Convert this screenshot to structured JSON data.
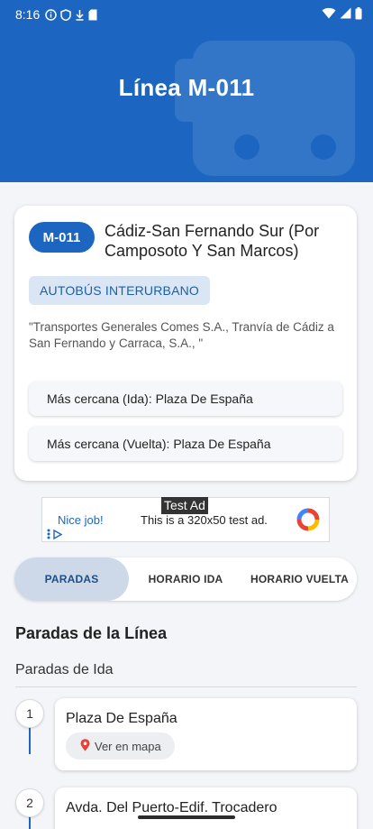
{
  "status_bar": {
    "time": "8:16"
  },
  "header": {
    "title": "Línea M-011"
  },
  "line": {
    "code": "M-011",
    "route_name": "Cádiz-San Fernando Sur (Por Camposoto Y San Marcos)",
    "type": "AUTOBÚS INTERURBANO",
    "operator": "\"Transportes Generales Comes S.A., Tranvía de Cádiz a San Fernando y Carraca, S.A., \"",
    "nearest_ida": "Más cercana (Ida): Plaza De España",
    "nearest_vuelta": "Más cercana (Vuelta): Plaza De España"
  },
  "ad": {
    "badge": "Test Ad",
    "left_text": "Nice job!",
    "body_text": "This is a 320x50 test ad."
  },
  "tabs": [
    {
      "label": "PARADAS",
      "active": true
    },
    {
      "label": "HORARIO IDA",
      "active": false
    },
    {
      "label": "HORARIO VUELTA",
      "active": false
    }
  ],
  "stops_section": {
    "title": "Paradas de la Línea",
    "subtitle": "Paradas de Ida",
    "map_button_label": "Ver en mapa",
    "stops": [
      {
        "number": "1",
        "name": "Plaza De España"
      },
      {
        "number": "2",
        "name": "Avda. Del Puerto-Edif. Trocadero"
      }
    ]
  },
  "colors": {
    "primary": "#1c66c1",
    "background": "#f3f5f9",
    "chip_bg": "#dbe6f4",
    "tab_active_bg": "#cdd9e8"
  }
}
